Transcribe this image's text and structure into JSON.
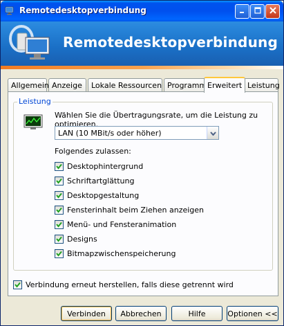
{
  "window": {
    "title": "Remotedesktopverbindung",
    "banner_title": "Remotedesktopverbindung"
  },
  "tabs": [
    {
      "label": "Allgemein",
      "active": false
    },
    {
      "label": "Anzeige",
      "active": false
    },
    {
      "label": "Lokale Ressourcen",
      "active": false
    },
    {
      "label": "Programme",
      "active": false
    },
    {
      "label": "Erweitert",
      "active": true
    },
    {
      "label": "Leistung",
      "active": false
    }
  ],
  "performance": {
    "group_label": "Leistung",
    "instruction": "Wählen Sie die Übertragungsrate, um die Leistung zu optimieren.",
    "connection_speed": "LAN (10 MBit/s oder höher)",
    "allow_label": "Folgendes zulassen:",
    "options": [
      {
        "label": "Desktophintergrund",
        "checked": true
      },
      {
        "label": "Schriftartglättung",
        "checked": true
      },
      {
        "label": "Desktopgestaltung",
        "checked": true
      },
      {
        "label": "Fensterinhalt beim Ziehen anzeigen",
        "checked": true
      },
      {
        "label": "Menü- und Fensteranimation",
        "checked": true
      },
      {
        "label": "Designs",
        "checked": true
      },
      {
        "label": "Bitmapzwischenspeicherung",
        "checked": true
      }
    ]
  },
  "reconnect": {
    "label": "Verbindung erneut herstellen, falls diese getrennt wird",
    "checked": true
  },
  "buttons": {
    "connect": "Verbinden",
    "cancel": "Abbrechen",
    "help": "Hilfe",
    "options": "Optionen <<"
  },
  "icons": {
    "app": "remote-desktop-icon",
    "minimize": "minimize-icon",
    "maximize": "maximize-icon",
    "close": "close-icon",
    "performance": "performance-monitor-icon",
    "dropdown": "chevron-down-icon",
    "check": "check-icon"
  },
  "colors": {
    "titlebar": "#0053ee",
    "banner": "#1a6fc6",
    "accent_stripe": "#f27b21",
    "group_label": "#0046d5",
    "active_tab_highlight": "#ffc83c"
  }
}
